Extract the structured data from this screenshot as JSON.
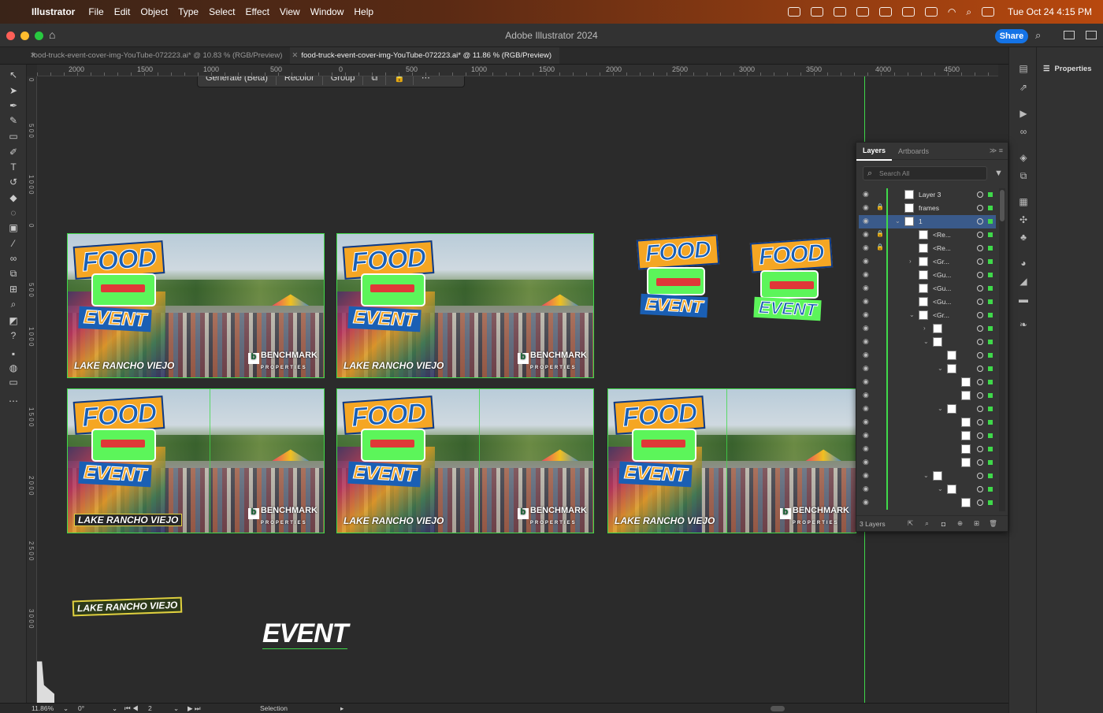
{
  "menubar": {
    "app": "Illustrator",
    "items": [
      "File",
      "Edit",
      "Object",
      "Type",
      "Select",
      "Effect",
      "View",
      "Window",
      "Help"
    ],
    "clock": "Tue Oct 24  4:15 PM"
  },
  "titlebar": {
    "title": "Adobe Illustrator 2024",
    "share": "Share"
  },
  "tabs": [
    {
      "label": "food-truck-event-cover-img-YouTube-072223.ai* @ 10.83 % (RGB/Preview)",
      "active": false
    },
    {
      "label": "food-truck-event-cover-img-YouTube-072223.ai* @ 11.86 % (RGB/Preview)",
      "active": true
    }
  ],
  "ruler": {
    "h_labels": [
      "2000",
      "1500",
      "1000",
      "500",
      "0",
      "500",
      "1000",
      "1500",
      "2000",
      "2500",
      "3000",
      "3500",
      "4000",
      "4500"
    ],
    "v_labels": [
      "0",
      "5 0 0",
      "1 0 0 0",
      "0",
      "5 0 0",
      "1 0 0 0",
      "1 5 0 0",
      "2 0 0 0",
      "2 5 0 0",
      "3 0 0 0"
    ]
  },
  "context_bar": {
    "generate": "Generate (Beta)",
    "recolor": "Recolor",
    "group": "Group"
  },
  "artwork": {
    "food": "FOOD",
    "event": "EVENT",
    "location": "LAKE RANCHO VIEJO",
    "brand": "BENCHMARK",
    "brand_sub": "PROPERTIES",
    "brand_mark": "b"
  },
  "properties": {
    "title": "Properties"
  },
  "layers_panel": {
    "tabs": [
      "Layers",
      "Artboards"
    ],
    "search_placeholder": "Search All",
    "count": "3 Layers",
    "rows": [
      {
        "name": "Layer 3",
        "indent": 0,
        "lock": false,
        "toggle": "",
        "sel": false
      },
      {
        "name": "frames",
        "indent": 0,
        "lock": true,
        "toggle": "",
        "sel": false
      },
      {
        "name": "1",
        "indent": 0,
        "lock": false,
        "toggle": "v",
        "sel": true
      },
      {
        "name": "<Re...",
        "indent": 1,
        "lock": true,
        "toggle": "",
        "sel": false
      },
      {
        "name": "<Re...",
        "indent": 1,
        "lock": true,
        "toggle": "",
        "sel": false
      },
      {
        "name": "<Gr...",
        "indent": 1,
        "lock": false,
        "toggle": ">",
        "sel": false
      },
      {
        "name": "<Gu...",
        "indent": 1,
        "lock": false,
        "toggle": "",
        "sel": false
      },
      {
        "name": "<Gu...",
        "indent": 1,
        "lock": false,
        "toggle": "",
        "sel": false
      },
      {
        "name": "<Gu...",
        "indent": 1,
        "lock": false,
        "toggle": "",
        "sel": false
      },
      {
        "name": "<Gr...",
        "indent": 1,
        "lock": false,
        "toggle": "v",
        "sel": false
      },
      {
        "name": "",
        "indent": 2,
        "lock": false,
        "toggle": ">",
        "sel": false
      },
      {
        "name": "",
        "indent": 2,
        "lock": false,
        "toggle": "v",
        "sel": false
      },
      {
        "name": "",
        "indent": 3,
        "lock": false,
        "toggle": "",
        "sel": false
      },
      {
        "name": "",
        "indent": 3,
        "lock": false,
        "toggle": "v",
        "sel": false
      },
      {
        "name": "",
        "indent": 4,
        "lock": false,
        "toggle": "",
        "sel": false
      },
      {
        "name": "",
        "indent": 4,
        "lock": false,
        "toggle": "",
        "sel": false
      },
      {
        "name": "",
        "indent": 3,
        "lock": false,
        "toggle": "v",
        "sel": false
      },
      {
        "name": "",
        "indent": 4,
        "lock": false,
        "toggle": "",
        "sel": false
      },
      {
        "name": "",
        "indent": 4,
        "lock": false,
        "toggle": "",
        "sel": false
      },
      {
        "name": "",
        "indent": 4,
        "lock": false,
        "toggle": "",
        "sel": false
      },
      {
        "name": "",
        "indent": 4,
        "lock": false,
        "toggle": "",
        "sel": false
      },
      {
        "name": "",
        "indent": 2,
        "lock": false,
        "toggle": "v",
        "sel": false
      },
      {
        "name": "",
        "indent": 3,
        "lock": false,
        "toggle": "v",
        "sel": false
      },
      {
        "name": "",
        "indent": 4,
        "lock": false,
        "toggle": "",
        "sel": false
      }
    ]
  },
  "status": {
    "zoom": "11.86%",
    "rotate": "0°",
    "artboard": "2",
    "tool": "Selection"
  },
  "colors": {
    "accent": "#1473e6",
    "guide": "#3fd94a",
    "food_fill": "#f5a623",
    "event_fill": "#1a5fb4",
    "truck": "#5cf55a"
  }
}
